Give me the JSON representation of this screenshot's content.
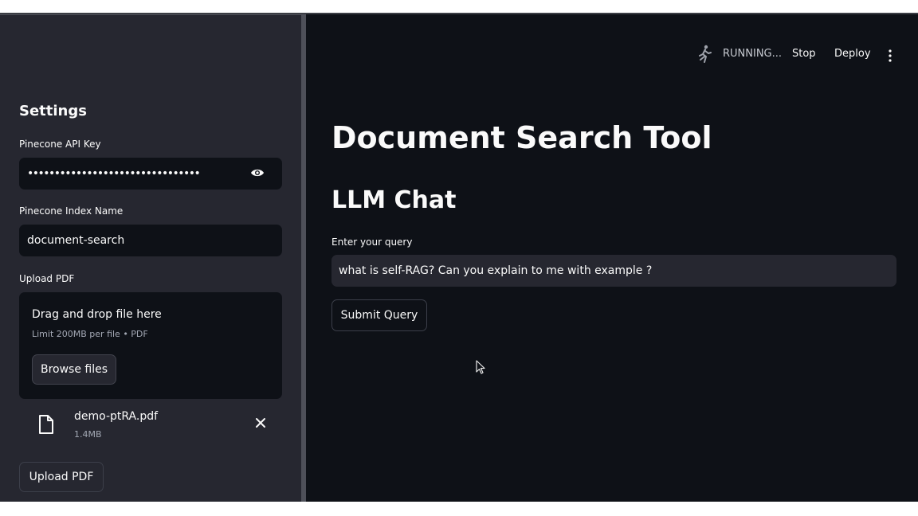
{
  "header": {
    "status": "RUNNING...",
    "stop_label": "Stop",
    "deploy_label": "Deploy",
    "icons": [
      "running-man-icon",
      "kebab-menu-icon"
    ]
  },
  "sidebar": {
    "title": "Settings",
    "api_key": {
      "label": "Pinecone API Key",
      "masked_value": "••••••••••••••••••••••••••••••••",
      "toggle_icon": "eye-icon"
    },
    "index": {
      "label": "Pinecone Index Name",
      "value": "document-search"
    },
    "upload": {
      "label": "Upload PDF",
      "drop_title": "Drag and drop file here",
      "drop_hint": "Limit 200MB per file • PDF",
      "browse_label": "Browse files",
      "file": {
        "name": "demo-ptRA.pdf",
        "size": "1.4MB",
        "icon": "file-icon"
      },
      "button_label": "Upload PDF"
    }
  },
  "main": {
    "title": "Document Search Tool",
    "subtitle": "LLM Chat",
    "query_label": "Enter your query",
    "query_value": "what is self-RAG? Can you explain to me with example ?",
    "submit_label": "Submit Query"
  },
  "colors": {
    "app_bg": "#0e1117",
    "sidebar_bg": "#262730",
    "text": "#fafafa",
    "muted": "#a3a8b4"
  }
}
